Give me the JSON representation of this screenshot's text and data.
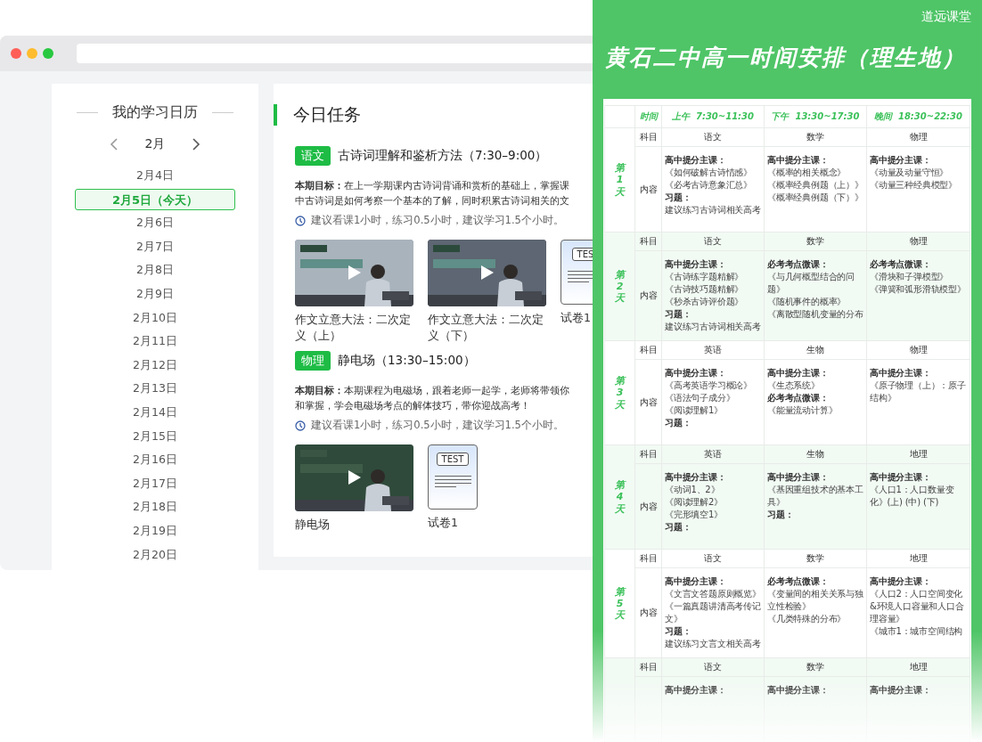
{
  "calendar": {
    "title": "我的学习日历",
    "month": "2月",
    "dates": [
      {
        "label": "2月4日",
        "selected": false
      },
      {
        "label": "2月5日（今天）",
        "selected": true
      },
      {
        "label": "2月6日",
        "selected": false
      },
      {
        "label": "2月7日",
        "selected": false
      },
      {
        "label": "2月8日",
        "selected": false
      },
      {
        "label": "2月9日",
        "selected": false
      },
      {
        "label": "2月10日",
        "selected": false
      },
      {
        "label": "2月11日",
        "selected": false
      },
      {
        "label": "2月12日",
        "selected": false
      },
      {
        "label": "2月13日",
        "selected": false
      },
      {
        "label": "2月14日",
        "selected": false
      },
      {
        "label": "2月15日",
        "selected": false
      },
      {
        "label": "2月16日",
        "selected": false
      },
      {
        "label": "2月17日",
        "selected": false
      },
      {
        "label": "2月18日",
        "selected": false
      },
      {
        "label": "2月19日",
        "selected": false
      },
      {
        "label": "2月20日",
        "selected": false
      }
    ]
  },
  "tasks": {
    "title": "今日任务",
    "items": [
      {
        "subject": "语文",
        "title": "古诗词理解和鉴析方法（7:30–9:00）",
        "goal_lines": [
          "**本期目标：**在上一学期课内古诗词背诵和赏析的基础上，掌握课",
          "中古诗词是如何考察一个基本的了解，同时积累古诗词相关的文"
        ],
        "hint": "建议看课1小时，练习0.5小时，建议学习1.5个小时。",
        "resources": [
          {
            "kind": "video",
            "title": "作文立意大法：二次定义（上）"
          },
          {
            "kind": "video",
            "title": "作文立意大法：二次定义（下）"
          },
          {
            "kind": "test",
            "badge": "TES",
            "title": "试卷1"
          }
        ]
      },
      {
        "subject": "物理",
        "title": "静电场（13:30–15:00）",
        "goal_lines": [
          "**本期目标：**本期课程为电磁场，跟着老师一起学，老师将带领你",
          "和掌握，学会电磁场考点的解体技巧，带你迎战高考！"
        ],
        "hint": "建议看课1小时，练习0.5小时，建议学习1.5个小时。",
        "resources": [
          {
            "kind": "video",
            "title": "静电场"
          },
          {
            "kind": "test",
            "badge": "TEST",
            "title": "试卷1"
          }
        ]
      }
    ]
  },
  "schedule": {
    "brand": "道远课堂",
    "title": "黄石二中高一时间安排（理生地）",
    "header": [
      "时间",
      "上午  7:30~11:30",
      "下午  13:30~17:30",
      "晚间  18:30~22:30"
    ],
    "days": [
      {
        "label": "第1天",
        "subject_label": "科目",
        "content_label": "内容",
        "subjects": [
          "语文",
          "数学",
          "物理"
        ],
        "contents": [
          [
            {
              "kind": "head",
              "text": "高中提分主课："
            },
            {
              "kind": "item",
              "text": "《如何破解古诗情感》"
            },
            {
              "kind": "item",
              "text": "《必考古诗意象汇总》"
            },
            {
              "kind": "head",
              "text": "习题："
            },
            {
              "kind": "item",
              "text": "建议练习古诗词相关高考"
            }
          ],
          [
            {
              "kind": "head",
              "text": "高中提分主课："
            },
            {
              "kind": "item",
              "text": "《概率的相关概念》"
            },
            {
              "kind": "item",
              "text": "《概率经典例题（上）》"
            },
            {
              "kind": "item",
              "text": "《概率经典例题（下）》"
            }
          ],
          [
            {
              "kind": "head",
              "text": "高中提分主课："
            },
            {
              "kind": "item",
              "text": "《动量及动量守恒》"
            },
            {
              "kind": "item",
              "text": "《动量三种经典模型》"
            }
          ]
        ]
      },
      {
        "label": "第2天",
        "subject_label": "科目",
        "content_label": "内容",
        "subjects": [
          "语文",
          "数学",
          "物理"
        ],
        "contents": [
          [
            {
              "kind": "head",
              "text": "高中提分主课："
            },
            {
              "kind": "item",
              "text": "《古诗练字题精解》"
            },
            {
              "kind": "item",
              "text": "《古诗技巧题精解》"
            },
            {
              "kind": "item",
              "text": "《秒杀古诗评价题》"
            },
            {
              "kind": "head",
              "text": "习题："
            },
            {
              "kind": "item",
              "text": "建议练习古诗词相关高考"
            }
          ],
          [
            {
              "kind": "head",
              "text": "必考考点微课："
            },
            {
              "kind": "item",
              "text": "《与几何概型结合的问题》"
            },
            {
              "kind": "item",
              "text": "《随机事件的概率》"
            },
            {
              "kind": "item",
              "text": "《离散型随机变量的分布"
            }
          ],
          [
            {
              "kind": "head",
              "text": "必考考点微课："
            },
            {
              "kind": "item",
              "text": "《滑块和子弹模型》"
            },
            {
              "kind": "item",
              "text": "《弹簧和弧形滑轨模型》"
            }
          ]
        ]
      },
      {
        "label": "第3天",
        "subject_label": "科目",
        "content_label": "内容",
        "subjects": [
          "英语",
          "生物",
          "物理"
        ],
        "contents": [
          [
            {
              "kind": "head",
              "text": "高中提分主课："
            },
            {
              "kind": "item",
              "text": "《高考英语学习概论》"
            },
            {
              "kind": "item",
              "text": "《语法句子成分》"
            },
            {
              "kind": "item",
              "text": "《阅读理解1》"
            },
            {
              "kind": "head",
              "text": "习题："
            }
          ],
          [
            {
              "kind": "head",
              "text": "高中提分主课："
            },
            {
              "kind": "item",
              "text": "《生态系统》"
            },
            {
              "kind": "head",
              "text": "必考考点微课："
            },
            {
              "kind": "item",
              "text": "《能量流动计算》"
            }
          ],
          [
            {
              "kind": "head",
              "text": "高中提分主课："
            },
            {
              "kind": "item",
              "text": "《原子物理（上）：原子结构》"
            }
          ]
        ]
      },
      {
        "label": "第4天",
        "subject_label": "科目",
        "content_label": "内容",
        "subjects": [
          "英语",
          "生物",
          "地理"
        ],
        "contents": [
          [
            {
              "kind": "head",
              "text": "高中提分主课："
            },
            {
              "kind": "item",
              "text": "《动词1、2》"
            },
            {
              "kind": "item",
              "text": "《阅读理解2》"
            },
            {
              "kind": "item",
              "text": "《完形填空1》"
            },
            {
              "kind": "head",
              "text": "习题："
            }
          ],
          [
            {
              "kind": "head",
              "text": "高中提分主课："
            },
            {
              "kind": "item",
              "text": "《基因重组技术的基本工具》"
            },
            {
              "kind": "head",
              "text": "习题："
            }
          ],
          [
            {
              "kind": "head",
              "text": "高中提分主课："
            },
            {
              "kind": "item",
              "text": "《人口1：人口数量变化》(上) (中) (下)"
            }
          ]
        ]
      },
      {
        "label": "第5天",
        "subject_label": "科目",
        "content_label": "内容",
        "subjects": [
          "语文",
          "数学",
          "地理"
        ],
        "contents": [
          [
            {
              "kind": "head",
              "text": "高中提分主课："
            },
            {
              "kind": "item",
              "text": "《文言文答题原则概览》"
            },
            {
              "kind": "item",
              "text": "《一篇真题讲清高考传记文》"
            },
            {
              "kind": "head",
              "text": "习题："
            },
            {
              "kind": "item",
              "text": "建议练习文言文相关高考"
            }
          ],
          [
            {
              "kind": "head",
              "text": "必考考点微课："
            },
            {
              "kind": "item",
              "text": "《变量间的相关关系与独立性检验》"
            },
            {
              "kind": "item",
              "text": "《几类特殊的分布》"
            }
          ],
          [
            {
              "kind": "head",
              "text": "高中提分主课："
            },
            {
              "kind": "item",
              "text": "《人口2：人口空间变化&环境人口容量和人口合理容量》"
            },
            {
              "kind": "item",
              "text": "《城市1：城市空间结构"
            }
          ]
        ]
      },
      {
        "subject_label": "科目",
        "subjects": [
          "语文",
          "数学",
          "地理"
        ],
        "contents": [
          [
            {
              "kind": "head",
              "text": "高中提分主课："
            }
          ],
          [
            {
              "kind": "head",
              "text": "高中提分主课："
            }
          ],
          [
            {
              "kind": "head",
              "text": "高中提分主课："
            }
          ]
        ]
      }
    ]
  }
}
